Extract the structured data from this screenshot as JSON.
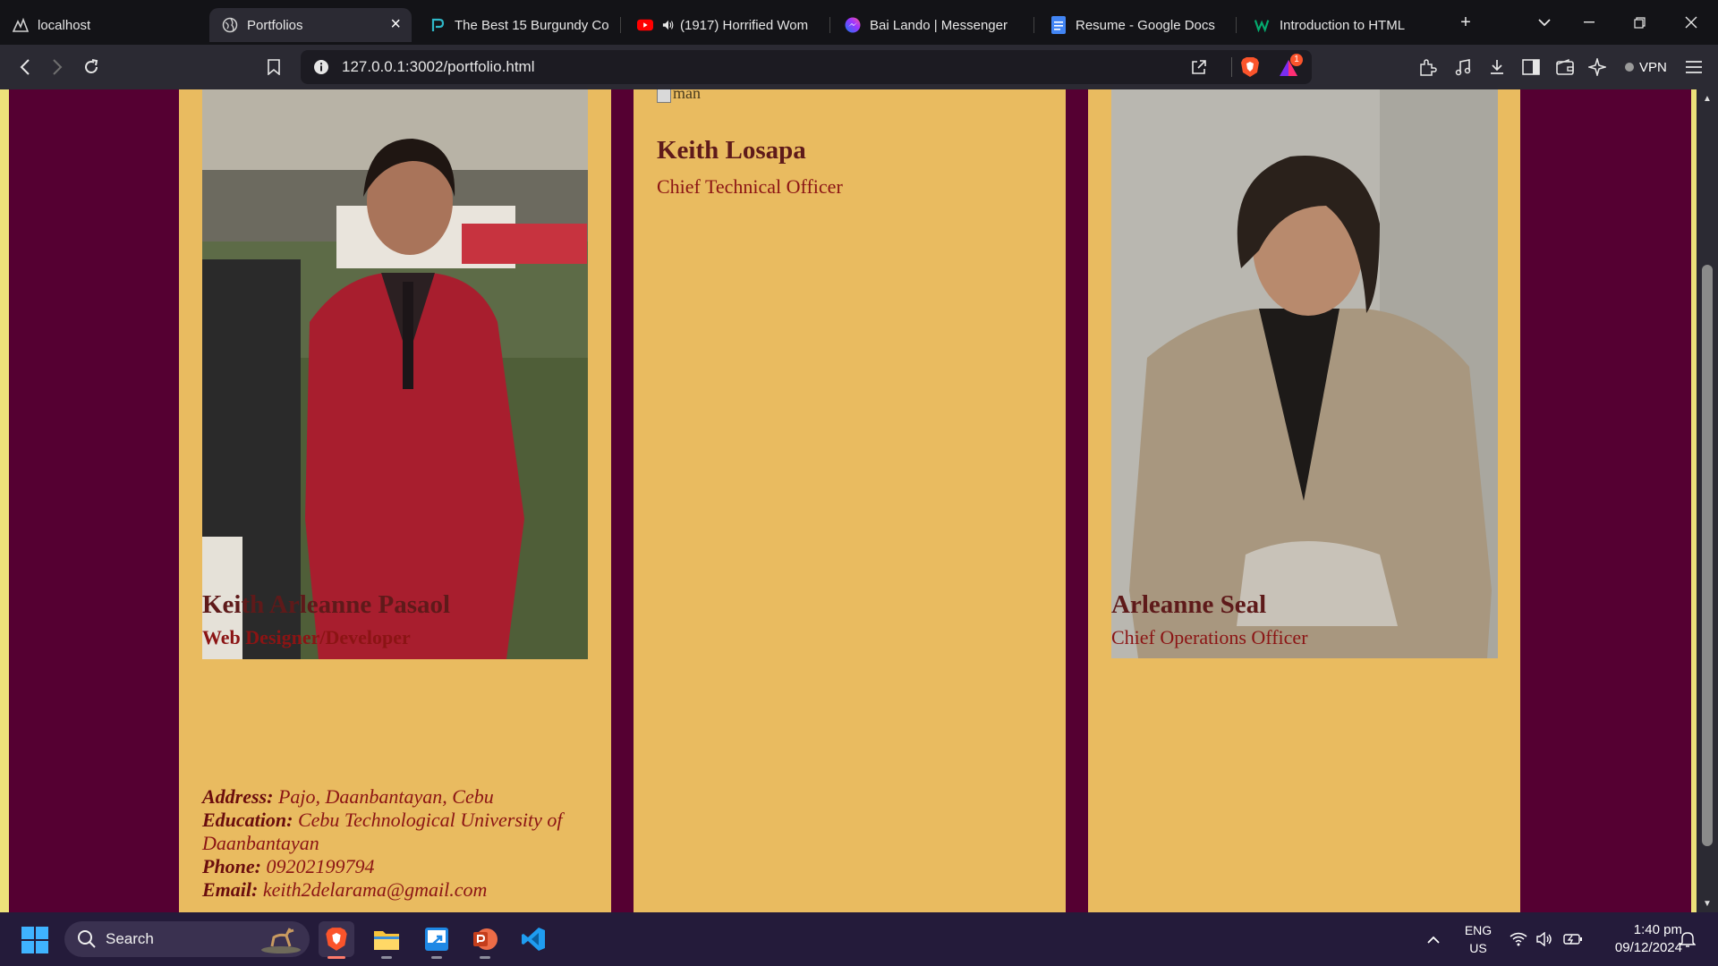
{
  "browser": {
    "tabs": [
      {
        "title": "localhost",
        "icon": "mountain-logo-icon"
      },
      {
        "title": "Portfolios",
        "icon": "globe-icon",
        "active": true
      },
      {
        "title": "The Best 15 Burgundy Co",
        "icon": "p-logo-icon"
      },
      {
        "title": "(1917) Horrified Wom",
        "icon": "youtube-icon"
      },
      {
        "title": "Bai Lando | Messenger",
        "icon": "messenger-icon"
      },
      {
        "title": "Resume - Google Docs",
        "icon": "google-docs-icon"
      },
      {
        "title": "Introduction to HTML",
        "icon": "w3-logo-icon"
      }
    ],
    "url": "127.0.0.1:3002/portfolio.html",
    "vpn_label": "VPN",
    "notification_badge": "1"
  },
  "page": {
    "cards": [
      {
        "name": "Keith Arleanne Pasaol",
        "role": "Web Designer/Developer",
        "details": [
          {
            "label": "Address:",
            "value": " Pajo, Daanbantayan, Cebu"
          },
          {
            "label": "Education:",
            "value": " Cebu Technological University of Daanbantayan"
          },
          {
            "label": "Phone:",
            "value": " 09202199794"
          },
          {
            "label": "Email:",
            "value": " keith2delarama@gmail.com"
          }
        ]
      },
      {
        "name": "Keith Losapa",
        "role": "Chief Technical Officer",
        "broken_image_alt": "man"
      },
      {
        "name": "Arleanne Seal",
        "role": "Chief Operations Officer"
      }
    ]
  },
  "taskbar": {
    "search_placeholder": "Search",
    "apps": [
      "brave-browser-icon",
      "file-explorer-icon",
      "remote-desktop-icon",
      "powerpoint-icon",
      "vscode-icon"
    ],
    "lang_line1": "ENG",
    "lang_line2": "US",
    "time": "1:40 pm",
    "date": "09/12/2024"
  },
  "colors": {
    "page_background": "#550032",
    "card_background": "#e9bb60",
    "name_color": "#5e1a1a",
    "role_color": "#8b1414",
    "edge_stripe": "#ede17a"
  }
}
